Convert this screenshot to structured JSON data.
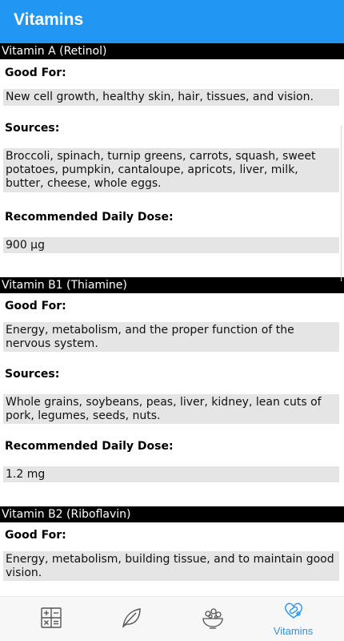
{
  "app": {
    "title": "Vitamins"
  },
  "vitamins": [
    {
      "name": "Vitamin A (Retinol)",
      "good_for_label": "Good For:",
      "good_for": "New cell growth, healthy skin, hair, tissues, and vision.",
      "sources_label": "Sources:",
      "sources": "Broccoli, spinach, turnip greens, carrots, squash, sweet potatoes, pumpkin, cantaloupe, apricots, liver, milk, butter, cheese, whole eggs.",
      "dose_label": "Recommended Daily Dose:",
      "dose": "900 µg"
    },
    {
      "name": "Vitamin B1 (Thiamine)",
      "good_for_label": "Good For:",
      "good_for": "Energy, metabolism, and the proper function of the nervous system.",
      "sources_label": "Sources:",
      "sources": "Whole grains, soybeans, peas, liver, kidney, lean cuts of pork, legumes, seeds, nuts.",
      "dose_label": "Recommended Daily Dose:",
      "dose": "1.2 mg"
    },
    {
      "name": "Vitamin B2 (Riboflavin)",
      "good_for_label": "Good For:",
      "good_for": "Energy, metabolism, building tissue, and to maintain good vision."
    }
  ],
  "bottom_nav": {
    "items": [
      {
        "icon": "calculator-icon",
        "label": ""
      },
      {
        "icon": "leaf-icon",
        "label": ""
      },
      {
        "icon": "food-bowl-icon",
        "label": ""
      },
      {
        "icon": "vitamins-icon",
        "label": "Vitamins",
        "active": true
      }
    ]
  },
  "colors": {
    "accent": "#2196f3",
    "header_bg": "#000000",
    "value_bg": "#e5e5e5",
    "icon_gray": "#555555"
  }
}
